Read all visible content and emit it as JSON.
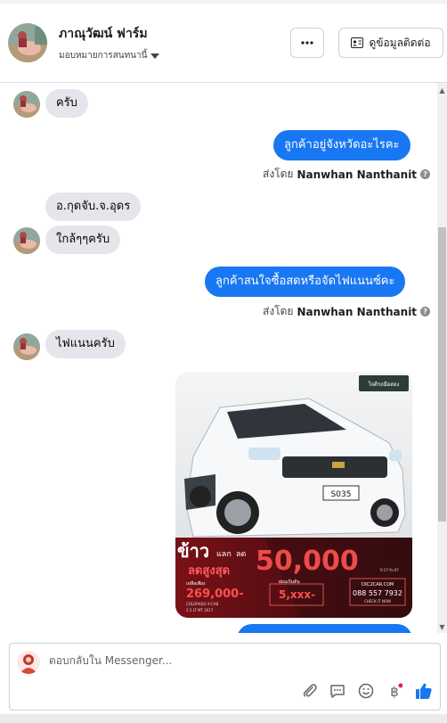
{
  "header": {
    "page_name": "ภาณุวัฒน์ ฟาร์ม",
    "assign_label": "มอบหมายการสนทนานี้",
    "contact_label": "ดูข้อมูลติดต่อ"
  },
  "messages": [
    {
      "direction": "in",
      "text": "ครับ"
    },
    {
      "direction": "out",
      "text": "ลูกค้าอยู่จังหวัดอะไรคะ",
      "sent_by_prefix": "ส่งโดย",
      "sender": "Nanwhan Nanthanit"
    },
    {
      "direction": "in",
      "text": "อ.กุดจับ.จ.อุดร"
    },
    {
      "direction": "in",
      "text": "ใกล้ๆๆครับ"
    },
    {
      "direction": "out",
      "text": "ลูกค้าสนใจซื้อสดหรือจัดไฟแนนซ์คะ",
      "sent_by_prefix": "ส่งโดย",
      "sender": "Nanwhan Nanthanit"
    },
    {
      "direction": "in",
      "text": "ไฟแนนครับ"
    }
  ],
  "ad": {
    "badge": "ใจดีรถมือสอง",
    "plate": "S035",
    "headline_main": "ข้าว",
    "headline_sub1": "แลก",
    "headline_sub2": "ลด",
    "headline_red": "ลดสูงสุด",
    "discount": "50,000",
    "year_note": "ปี 17 ถึง 07",
    "price_label": "เหลือเพียง",
    "price": "269,000-",
    "down_label": "ผ่อนเริ่มต้น",
    "down": "5,xxx-",
    "model": "COLORADO X-CAB",
    "spec": "2.5 LT MT 2017",
    "website": "CKC2CAR.COM",
    "phone": "088 557 7932",
    "check": "CHECK IT NOW"
  },
  "composer": {
    "placeholder": "ตอบกลับใน Messenger..."
  },
  "colors": {
    "accent": "#1877f2",
    "bubble_in": "#e4e6eb",
    "notification_dot": "#e41e3f"
  }
}
